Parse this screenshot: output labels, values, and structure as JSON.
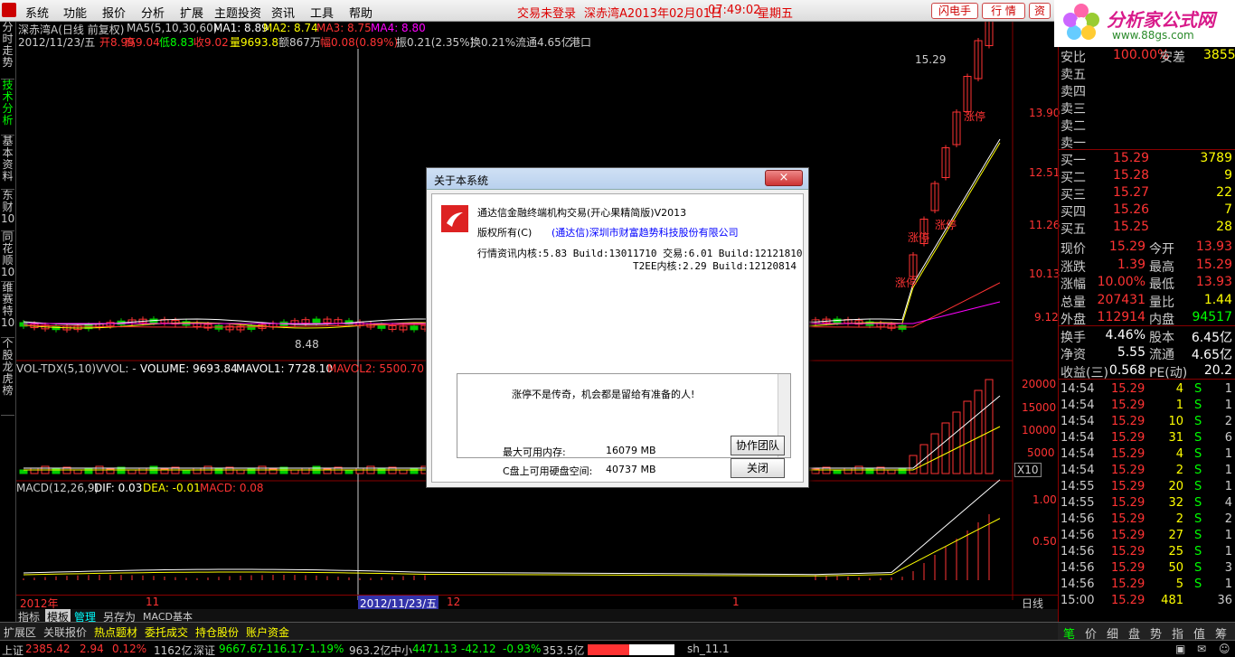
{
  "menu": {
    "items": [
      "系统",
      "功能",
      "报价",
      "分析",
      "扩展",
      "主题投资",
      "资讯",
      "工具",
      "帮助"
    ],
    "status": "交易未登录",
    "stock_date": "深赤湾A2013年02月01日",
    "time": "07:49:02",
    "weekday": "星期五",
    "btn_flash": "闪电手",
    "btn_quote": "行 情",
    "btn_more": "资"
  },
  "logo": {
    "name": "分析家公式网",
    "url": "www.88gs.com"
  },
  "left_tabs": [
    "分时走势",
    "技术分析",
    "基本资料",
    "东财10",
    "同花顺10",
    "维赛特10",
    "个股龙虎榜"
  ],
  "chart": {
    "header": "深赤湾A(日线 前复权)",
    "ma5": "MA5(5,10,30,60)",
    "ma1": "MA1: 8.89",
    "ma2": "MA2: 8.74",
    "ma3": "MA3: 8.75",
    "ma4": "MA4: 8.80",
    "date": "2012/11/23/五",
    "open": "开8.99",
    "high": "高9.04",
    "low": "低8.83",
    "close": "收9.02",
    "volume": "量9693.8",
    "amount": "额867万",
    "change": "幅0.08(0.89%)",
    "amplitude": "振0.21(2.35%)",
    "turnover": "换0.21%",
    "float": "流通4.65亿",
    "port": "港口",
    "price_levels": [
      "13.90",
      "12.51",
      "11.26",
      "10.13",
      "9.12"
    ],
    "high_label": "15.29",
    "low_label": "8.48",
    "limit_up": "涨停",
    "vol_header": "VOL-TDX(5,10)",
    "vvol": "VVOL: -",
    "volume_v": "VOLUME: 9693.84",
    "mavol1": "MAVOL1: 7728.10",
    "mavol2": "MAVOL2: 5500.70",
    "vol_levels": [
      "20000",
      "15000",
      "10000",
      "5000"
    ],
    "vol_unit": "X10",
    "macd_header": "MACD(12,26,9)",
    "dif": "DIF: 0.03",
    "dea": "DEA: -0.01",
    "macd": "MACD: 0.08",
    "macd_levels": [
      "1.00",
      "0.50"
    ],
    "x_labels": [
      "2012年",
      "11",
      "2012/11/23/五",
      "12",
      "1"
    ],
    "period": "日线"
  },
  "quote": {
    "sell_labels": [
      "安比",
      "卖五",
      "卖四",
      "卖三",
      "卖二",
      "卖一"
    ],
    "sell_top": "100.00%",
    "sell_top2": "安差",
    "sell_top_v": "3855",
    "buy": [
      {
        "label": "买一",
        "price": "15.29",
        "vol": "3789"
      },
      {
        "label": "买二",
        "price": "15.28",
        "vol": "9"
      },
      {
        "label": "买三",
        "price": "15.27",
        "vol": "22"
      },
      {
        "label": "买四",
        "price": "15.26",
        "vol": "7"
      },
      {
        "label": "买五",
        "price": "15.25",
        "vol": "28"
      }
    ],
    "stats": [
      {
        "l1": "现价",
        "v1": "15.29",
        "l2": "今开",
        "v2": "13.93"
      },
      {
        "l1": "涨跌",
        "v1": "1.39",
        "l2": "最高",
        "v2": "15.29"
      },
      {
        "l1": "涨幅",
        "v1": "10.00%",
        "l2": "最低",
        "v2": "13.93"
      },
      {
        "l1": "总量",
        "v1": "207431",
        "l2": "量比",
        "v2": "1.44"
      },
      {
        "l1": "外盘",
        "v1": "112914",
        "l2": "内盘",
        "v2": "94517"
      },
      {
        "l1": "换手",
        "v1": "4.46%",
        "l2": "股本",
        "v2": "6.45亿"
      },
      {
        "l1": "净资",
        "v1": "5.55",
        "l2": "流通",
        "v2": "4.65亿"
      },
      {
        "l1": "收益(三)",
        "v1": "0.568",
        "l2": "PE(动)",
        "v2": "20.2"
      }
    ],
    "ticks": [
      {
        "t": "14:54",
        "p": "15.29",
        "v": "4",
        "s": "S",
        "n": "1"
      },
      {
        "t": "14:54",
        "p": "15.29",
        "v": "1",
        "s": "S",
        "n": "1"
      },
      {
        "t": "14:54",
        "p": "15.29",
        "v": "10",
        "s": "S",
        "n": "2"
      },
      {
        "t": "14:54",
        "p": "15.29",
        "v": "31",
        "s": "S",
        "n": "6"
      },
      {
        "t": "14:54",
        "p": "15.29",
        "v": "4",
        "s": "S",
        "n": "1"
      },
      {
        "t": "14:54",
        "p": "15.29",
        "v": "2",
        "s": "S",
        "n": "1"
      },
      {
        "t": "14:55",
        "p": "15.29",
        "v": "20",
        "s": "S",
        "n": "1"
      },
      {
        "t": "14:55",
        "p": "15.29",
        "v": "32",
        "s": "S",
        "n": "4"
      },
      {
        "t": "14:56",
        "p": "15.29",
        "v": "2",
        "s": "S",
        "n": "2"
      },
      {
        "t": "14:56",
        "p": "15.29",
        "v": "27",
        "s": "S",
        "n": "1"
      },
      {
        "t": "14:56",
        "p": "15.29",
        "v": "25",
        "s": "S",
        "n": "1"
      },
      {
        "t": "14:56",
        "p": "15.29",
        "v": "50",
        "s": "S",
        "n": "3"
      },
      {
        "t": "14:56",
        "p": "15.29",
        "v": "5",
        "s": "S",
        "n": "1"
      },
      {
        "t": "15:00",
        "p": "15.29",
        "v": "481",
        "s": "",
        "n": "36"
      }
    ]
  },
  "dialog": {
    "title": "关于本系统",
    "close": "×",
    "product": "通达信金融终端机构交易(开心果精简版)V2013",
    "copyright": "版权所有(C)",
    "company": "(通达信)深圳市财富趋势科技股份有限公司",
    "kernel": "行情资讯内核:5.83 Build:13011710 交易:6.01 Build:12121810",
    "t2ee": "T2EE内核:2.29 Build:12120814",
    "message": "涨停不是传奇，机会都是留给有准备的人!",
    "mem_label": "最大可用内存:",
    "mem_value": "16079 MB",
    "disk_label": "C盘上可用硬盘空间:",
    "disk_value": "40737 MB",
    "btn_team": "协作团队",
    "btn_close": "关闭"
  },
  "bottom_tabs": [
    "指标",
    "模板",
    "管理",
    "另存为",
    "MACD基本"
  ],
  "func_tabs": [
    "扩展区",
    "关联报价",
    "热点题材",
    "委托成交",
    "持仓股份",
    "账户资金"
  ],
  "right_tabs": [
    "笔",
    "价",
    "细",
    "盘",
    "势",
    "指",
    "值",
    "筹"
  ],
  "status": {
    "sz_label": "上证",
    "sz_idx": "2385.42",
    "sz_chg": "2.94",
    "sz_pct": "0.12%",
    "sz_amt": "1162亿",
    "zs_label": "深证",
    "zs_idx": "9667.67",
    "zs_chg": "-116.17",
    "zs_pct": "-1.19%",
    "zs_amt": "963.2亿",
    "zx_label": "中小",
    "zx_idx": "4471.13",
    "zx_chg": "-42.12",
    "zx_pct": "-0.93%",
    "zx_amt": "353.5亿",
    "server": "sh_11.1"
  },
  "colors": {
    "up": "#ff3232",
    "down": "#00e600",
    "yellow": "#ffff00",
    "cyan": "#00c8c8",
    "magenta": "#ff00ff",
    "ma_white": "#ffffff"
  }
}
